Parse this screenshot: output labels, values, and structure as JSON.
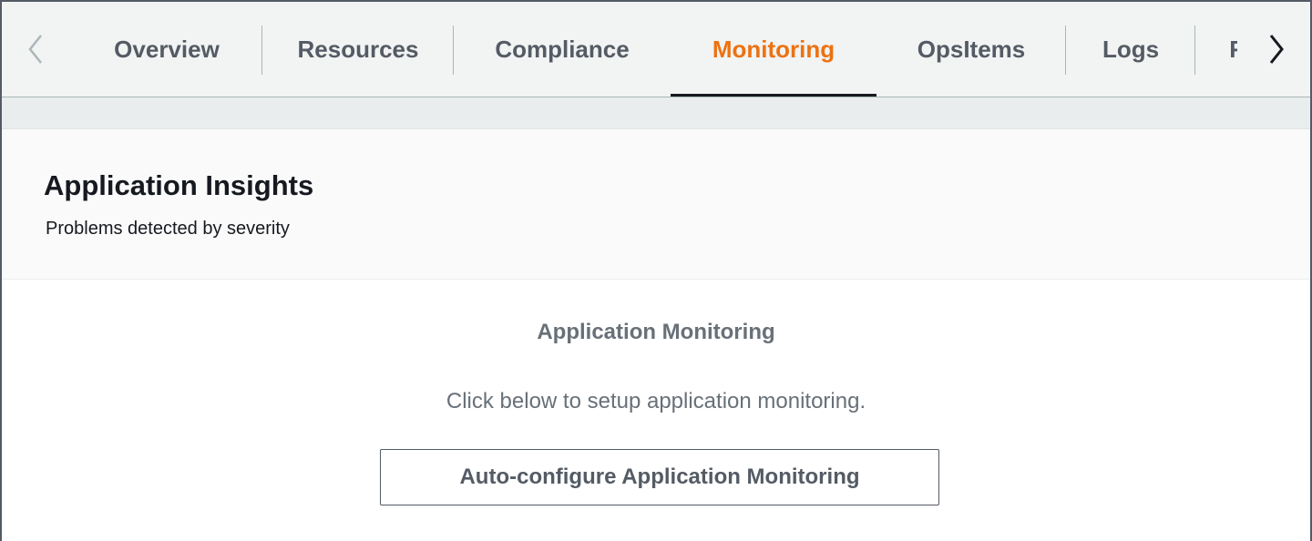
{
  "tabs": [
    {
      "label": "Overview",
      "active": false
    },
    {
      "label": "Resources",
      "active": false
    },
    {
      "label": "Compliance",
      "active": false
    },
    {
      "label": "Monitoring",
      "active": true
    },
    {
      "label": "OpsItems",
      "active": false
    },
    {
      "label": "Logs",
      "active": false
    },
    {
      "label": "R",
      "active": false
    }
  ],
  "icons": {
    "scroll_left": "chevron-left-icon",
    "scroll_right": "chevron-right-icon"
  },
  "colors": {
    "active_tab": "#ec7211",
    "tab_text": "#545b64",
    "title_text": "#16191f",
    "muted_text": "#687078"
  },
  "card": {
    "title": "Application Insights",
    "subtitle": "Problems detected by severity"
  },
  "empty_state": {
    "title": "Application Monitoring",
    "description": "Click below to setup application monitoring.",
    "button_label": "Auto-configure Application Monitoring"
  }
}
